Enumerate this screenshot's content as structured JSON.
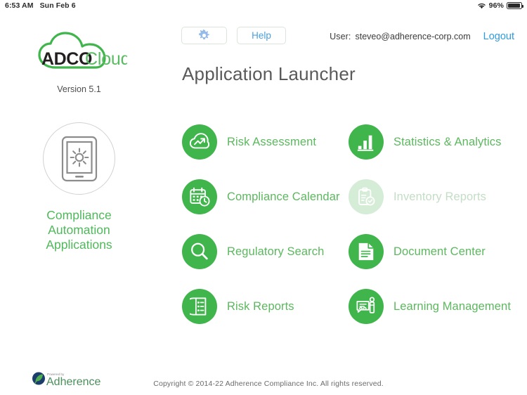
{
  "statusbar": {
    "time": "6:53 AM",
    "date": "Sun Feb 6",
    "wifi_icon": "wifi-icon",
    "battery_percent": "96%",
    "battery_icon": "battery-icon"
  },
  "brand": {
    "logo_primary": "ADCO",
    "logo_secondary": "Cloud",
    "logo_icon": "cloud-icon",
    "version": "Version 5.1"
  },
  "sidebar_tile": {
    "icon": "tablet-gear-icon",
    "label_line1": "Compliance",
    "label_line2": "Automation",
    "label_line3": "Applications"
  },
  "toolbar": {
    "settings_icon": "gear-icon",
    "help_label": "Help"
  },
  "account": {
    "user_label": "User:",
    "user_email": "steveo@adherence-corp.com",
    "logout_label": "Logout"
  },
  "main": {
    "title": "Application Launcher"
  },
  "apps": [
    {
      "label": "Risk Assessment",
      "icon": "cloud-arrow-up-icon",
      "disabled": false
    },
    {
      "label": "Statistics & Analytics",
      "icon": "bar-chart-icon",
      "disabled": false
    },
    {
      "label": "Compliance Calendar",
      "icon": "calendar-clock-icon",
      "disabled": false
    },
    {
      "label": "Inventory Reports",
      "icon": "clipboard-check-icon",
      "disabled": true
    },
    {
      "label": "Regulatory Search",
      "icon": "magnifier-icon",
      "disabled": false
    },
    {
      "label": "Document Center",
      "icon": "document-icon",
      "disabled": false
    },
    {
      "label": "Risk Reports",
      "icon": "report-list-icon",
      "disabled": false
    },
    {
      "label": "Learning Management",
      "icon": "certificate-icon",
      "disabled": false
    }
  ],
  "footer": {
    "powered_by": "Powered by",
    "powered_brand": "Adherence",
    "powered_icon": "leaf-circle-icon",
    "copyright": "Copyright © 2014-22  Adherence Compliance Inc. All rights reserved."
  },
  "colors": {
    "brand_green": "#3fb54b",
    "label_green": "#5cb85f",
    "link_blue": "#2f9ae0",
    "disabled_green": "#d5ecd7"
  }
}
